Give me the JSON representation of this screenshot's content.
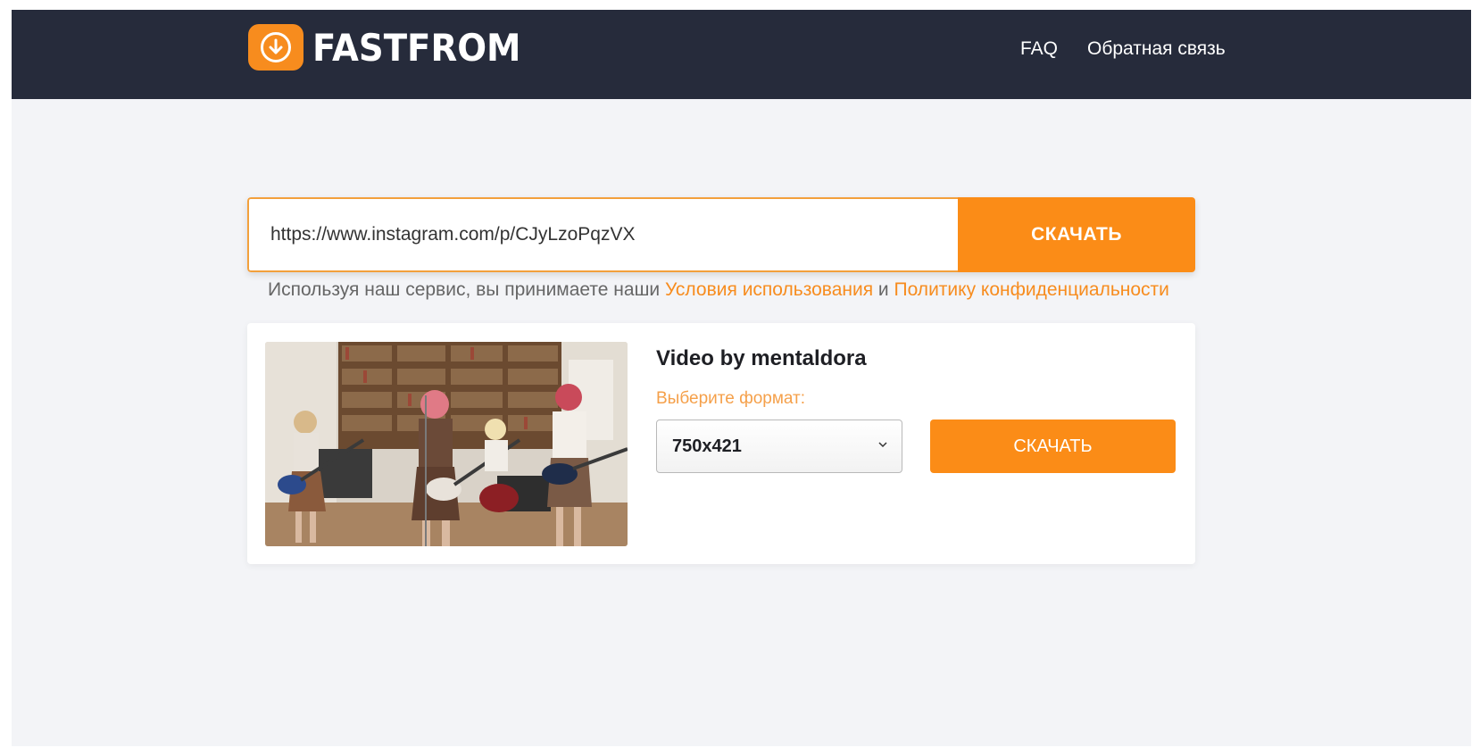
{
  "header": {
    "logo_text": "FASTFROM",
    "nav": {
      "faq": "FAQ",
      "feedback": "Обратная связь"
    }
  },
  "search": {
    "url_value": "https://www.instagram.com/p/CJyLzoPqzVX",
    "button_label": "СКАЧАТЬ"
  },
  "terms": {
    "prefix": "Используя наш сервис, вы принимаете наши ",
    "terms_link": "Условия использования",
    "and": " и ",
    "privacy_link": "Политику конфиденциальности"
  },
  "result": {
    "title": "Video by mentaldora",
    "format_label": "Выберите формат:",
    "format_selected": "750x421",
    "download_label": "СКАЧАТЬ"
  },
  "colors": {
    "accent": "#fb8c17",
    "header_bg": "#262b3b",
    "page_bg": "#f3f4f7"
  },
  "icons": {
    "logo": "download-arrow-icon",
    "select": "chevron-down-icon"
  }
}
